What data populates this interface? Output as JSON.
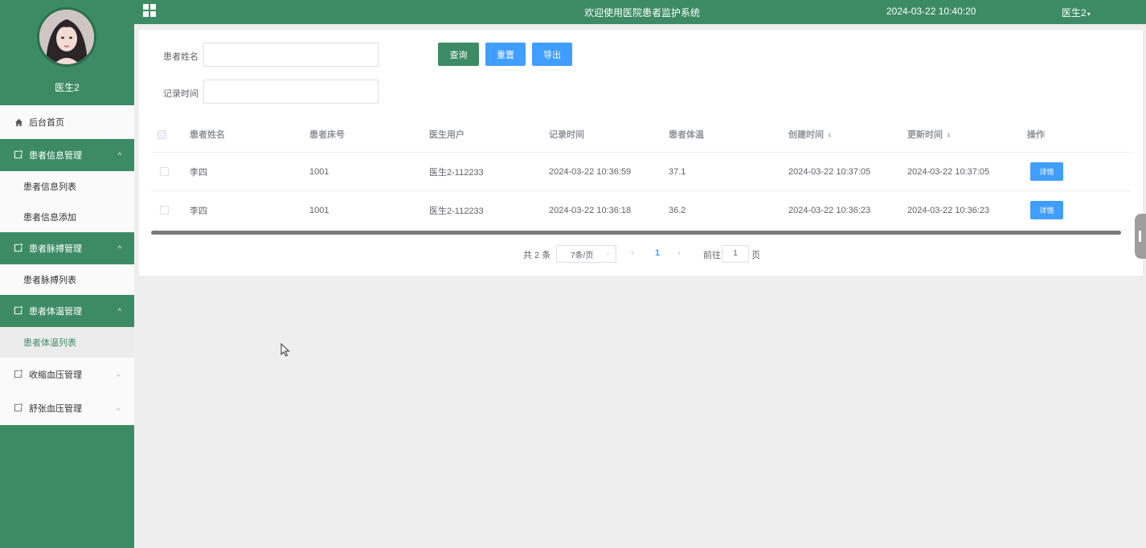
{
  "sidebar": {
    "user_name": "医生2",
    "menu": {
      "home": "后台首页",
      "group1": "患者信息管理",
      "group1_sub1": "患者信息列表",
      "group1_sub2": "患者信息添加",
      "group2": "患者脉搏管理",
      "group2_sub1": "患者脉搏列表",
      "group3": "患者体温管理",
      "group3_sub1": "患者体温列表",
      "group4": "收缩血压管理",
      "group5": "舒张血压管理"
    }
  },
  "header": {
    "title": "欢迎使用医院患者监护系统",
    "datetime": "2024-03-22 10:40:20",
    "user": "医生2"
  },
  "search": {
    "name_label": "患者姓名",
    "time_label": "记录时间",
    "query_btn": "查询",
    "reset_btn": "重置",
    "export_btn": "导出"
  },
  "table": {
    "headers": [
      "患者姓名",
      "患者床号",
      "医生用户",
      "记录时间",
      "患者体温",
      "创建时间",
      "更新时间",
      "操作"
    ],
    "rows": [
      {
        "name": "李四",
        "bed": "1001",
        "doctor": "医生2-112233",
        "record_time": "2024-03-22 10:36:59",
        "temp": "37.1",
        "created": "2024-03-22 10:37:05",
        "updated": "2024-03-22 10:37:05",
        "action": "详情"
      },
      {
        "name": "李四",
        "bed": "1001",
        "doctor": "医生2-112233",
        "record_time": "2024-03-22 10:36:18",
        "temp": "36.2",
        "created": "2024-03-22 10:36:23",
        "updated": "2024-03-22 10:36:23",
        "action": "详情"
      }
    ]
  },
  "pagination": {
    "total": "共 2 条",
    "page_size": "7条/页",
    "current_page": "1",
    "goto_label": "前往",
    "goto_value": "1",
    "page_unit": "页"
  },
  "colors": {
    "primary_green": "#3d8b64",
    "primary_blue": "#409eff"
  }
}
